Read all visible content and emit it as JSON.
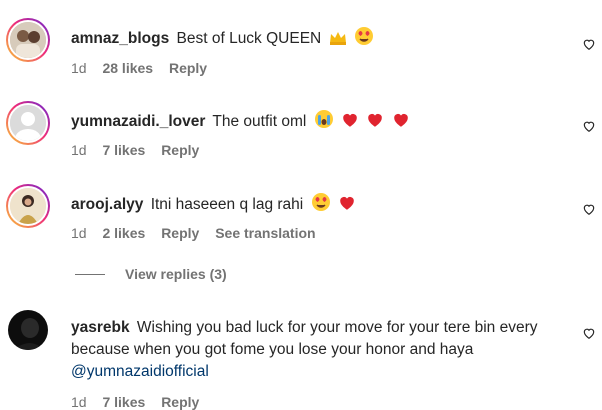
{
  "comments": [
    {
      "username": "amnaz_blogs",
      "text": "Best of Luck QUEEN",
      "emojis": [
        "crown-emoji",
        "heart-eyes-emoji"
      ],
      "time": "1d",
      "likes": "28 likes",
      "reply": "Reply"
    },
    {
      "username": "yumnazaidi._lover",
      "text": "The outfit oml",
      "emojis": [
        "crying-emoji",
        "red-heart-emoji",
        "red-heart-emoji",
        "red-heart-emoji"
      ],
      "time": "1d",
      "likes": "7 likes",
      "reply": "Reply"
    },
    {
      "username": "arooj.alyy",
      "text": "Itni haseeen q lag rahi",
      "emojis": [
        "heart-eyes-emoji",
        "red-heart-emoji"
      ],
      "time": "1d",
      "likes": "2 likes",
      "reply": "Reply",
      "translate": "See translation"
    },
    {
      "username": "yasrebk",
      "text": "Wishing you bad luck for your move for your tere bin every because when you got fome you lose your honor and haya",
      "mention": "@yumnazaidiofficial",
      "time": "1d",
      "likes": "7 likes",
      "reply": "Reply"
    }
  ],
  "view_replies": "View replies (3)",
  "colors": {
    "text": "#262626",
    "meta": "#737373",
    "mention": "#00376b"
  }
}
